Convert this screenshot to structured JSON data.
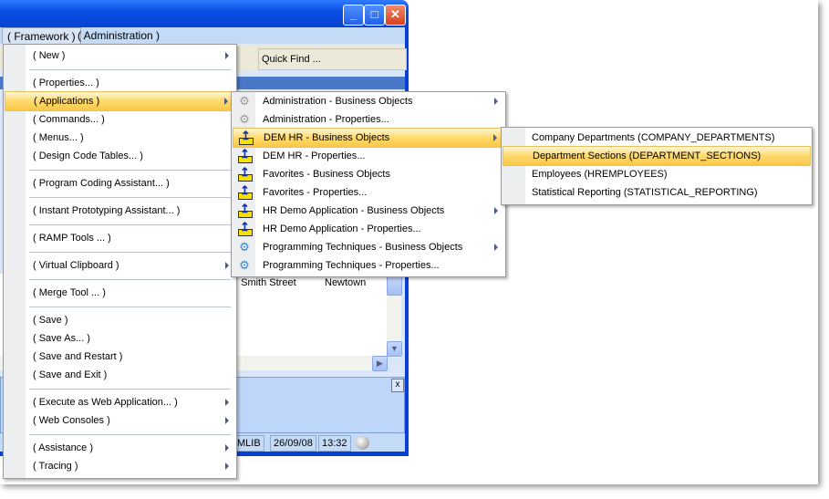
{
  "menubar": [
    "( Framework )",
    "( Administration )"
  ],
  "toolbar": {
    "quick_find": "Quick Find ..."
  },
  "list": {
    "street": ". Smith Street",
    "city": "Newtown"
  },
  "panel": {
    "close": "x"
  },
  "status": {
    "lib": "MLIB",
    "date": "26/09/08",
    "time": "13:32"
  },
  "main_menu": [
    {
      "label": "( New )",
      "sub": true
    },
    {
      "label": "( Properties... )"
    },
    {
      "label": "( Applications )",
      "sub": true,
      "highlight": true
    },
    {
      "label": "( Commands... )"
    },
    {
      "label": "( Menus... )"
    },
    {
      "label": "( Design Code Tables... )"
    },
    {
      "label": "( Program Coding Assistant... )"
    },
    {
      "label": "( Instant Prototyping Assistant... )"
    },
    {
      "label": "( RAMP Tools ... )"
    },
    {
      "label": "( Virtual Clipboard )",
      "sub": true
    },
    {
      "label": "( Merge Tool ... )"
    },
    {
      "label": "( Save )"
    },
    {
      "label": "( Save As... )"
    },
    {
      "label": "( Save and Restart )"
    },
    {
      "label": "( Save and Exit )"
    },
    {
      "label": "( Execute as Web Application... )",
      "sub": true
    },
    {
      "label": "( Web Consoles )",
      "sub": true
    },
    {
      "label": "( Assistance )",
      "sub": true
    },
    {
      "label": "( Tracing )",
      "sub": true
    }
  ],
  "apps_menu": [
    {
      "label": "Administration - Business Objects",
      "icon": "gears",
      "sub": true
    },
    {
      "label": "Administration - Properties...",
      "icon": "gears"
    },
    {
      "label": "DEM HR - Business Objects",
      "icon": "tray",
      "sub": true,
      "highlight": true
    },
    {
      "label": "DEM HR - Properties...",
      "icon": "tray"
    },
    {
      "label": "Favorites - Business Objects",
      "icon": "tray"
    },
    {
      "label": "Favorites - Properties...",
      "icon": "tray"
    },
    {
      "label": "HR Demo Application - Business Objects",
      "icon": "tray",
      "sub": true
    },
    {
      "label": "HR Demo Application - Properties...",
      "icon": "tray"
    },
    {
      "label": "Programming Techniques - Business Objects",
      "icon": "gear-blue",
      "sub": true
    },
    {
      "label": "Programming Techniques - Properties...",
      "icon": "gear-blue"
    }
  ],
  "objects_menu": [
    {
      "label": "Company Departments  (COMPANY_DEPARTMENTS)"
    },
    {
      "label": "Department Sections  (DEPARTMENT_SECTIONS)",
      "highlight": true
    },
    {
      "label": "Employees  (HREMPLOYEES)"
    },
    {
      "label": "Statistical Reporting  (STATISTICAL_REPORTING)"
    }
  ]
}
